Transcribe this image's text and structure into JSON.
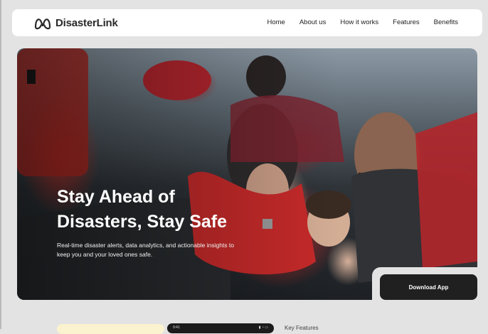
{
  "brand": {
    "name": "DisasterLink",
    "logo_icon": "disasterlink-logo-icon"
  },
  "nav": {
    "links": [
      "Home",
      "About us",
      "How it works",
      "Features",
      "Benefits"
    ]
  },
  "hero": {
    "title_line1": "Stay Ahead of",
    "title_line2": "Disasters, Stay Safe",
    "subtitle": "Real-time disaster alerts, data analytics, and actionable insights to keep you and your loved ones safe.",
    "photo": "refugees-in-life-jackets-on-boat"
  },
  "download": {
    "label": "Download App"
  },
  "below": {
    "phone_time": "9:41",
    "phone_status": "▮ ◔ ▭",
    "key_features": "Key Features"
  },
  "colors": {
    "page_bg": "#e3e3e3",
    "nav_bg": "#ffffff",
    "button_bg": "#202020",
    "card_peek": "#fbf2cf",
    "life_jacket_red": "#c22a2a"
  }
}
